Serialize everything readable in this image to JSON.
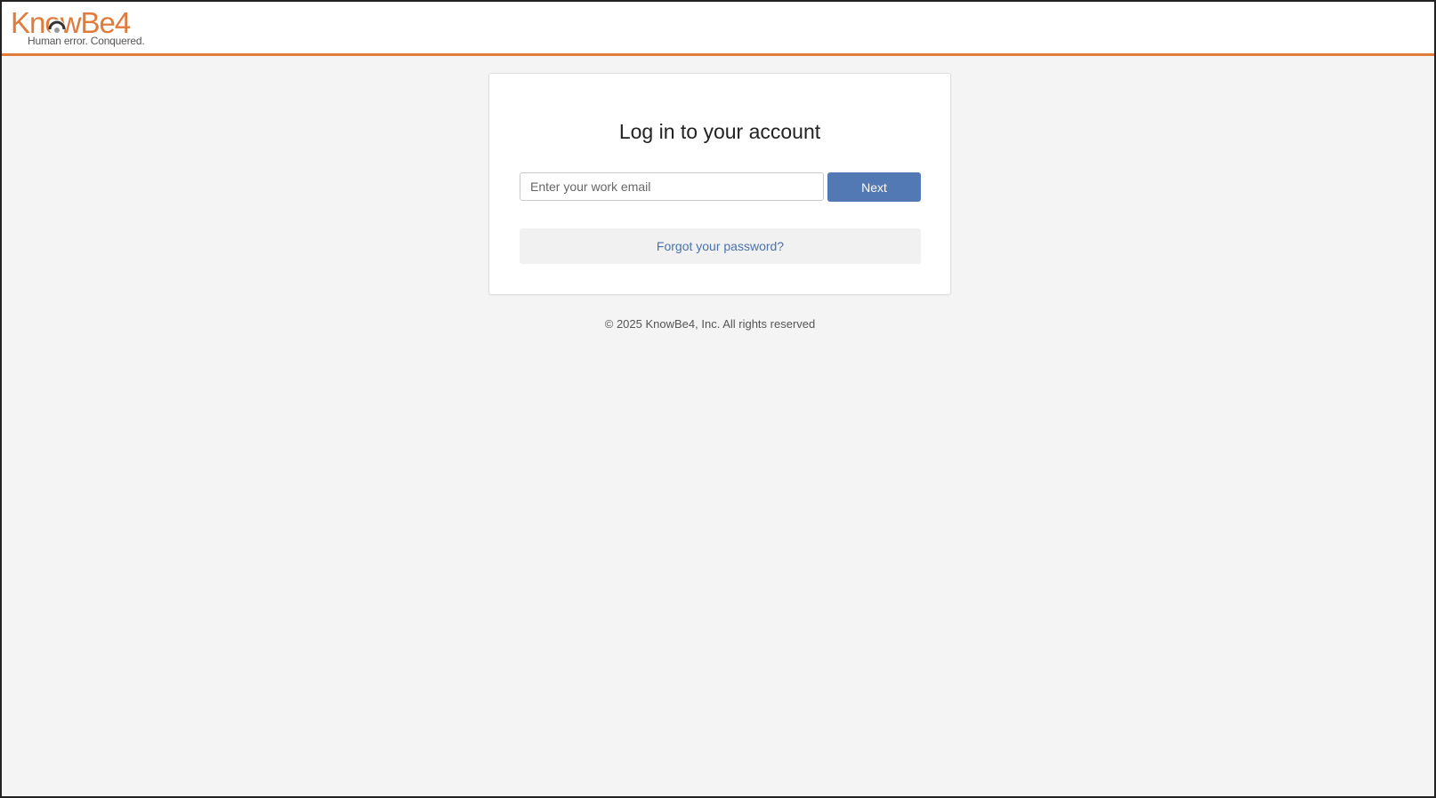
{
  "brand": {
    "name": "KnowBe4",
    "tagline": "Human error. Conquered.",
    "accent_color": "#e07b3c"
  },
  "login": {
    "title": "Log in to your account",
    "email_placeholder": "Enter your work email",
    "email_value": "",
    "next_label": "Next",
    "forgot_label": "Forgot your password?",
    "button_color": "#5379b4"
  },
  "footer": {
    "copyright": "© 2025 KnowBe4, Inc. All rights reserved"
  }
}
